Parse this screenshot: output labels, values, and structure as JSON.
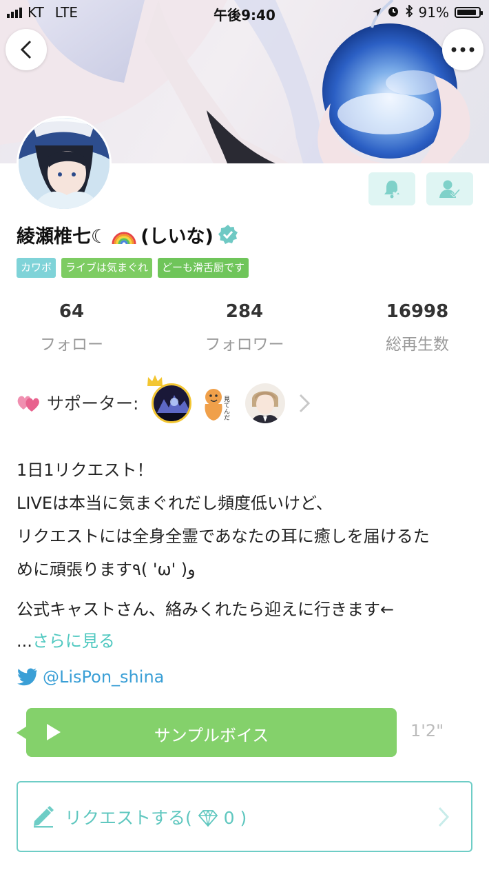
{
  "status_bar": {
    "carrier": "KT",
    "network": "LTE",
    "time": "午後9:40",
    "battery": "91%",
    "battery_level": 0.91
  },
  "header": {
    "back_icon": "chevron-left-icon",
    "more_icon": "more-horizontal-icon"
  },
  "actions": {
    "notify_icon": "bell-check-icon",
    "follow_icon": "user-check-icon",
    "accent": "#dff5f3",
    "icon_color": "#7fd1c9"
  },
  "profile": {
    "name": "綾瀬椎七☾",
    "name_suffix": "(しいな)",
    "rainbow_icon": "rainbow-icon",
    "verified_icon": "verified-badge-icon",
    "tags": [
      {
        "label": "カワボ",
        "color": "#7fd3d8"
      },
      {
        "label": "ライブは気まぐれ",
        "color": "#7dcc62"
      },
      {
        "label": "どーも滑舌厨です",
        "color": "#6fc55a"
      }
    ]
  },
  "stats": [
    {
      "value": "64",
      "label": "フォロー"
    },
    {
      "value": "284",
      "label": "フォロワー"
    },
    {
      "value": "16998",
      "label": "総再生数"
    }
  ],
  "supporters": {
    "label": "サポーター:",
    "heart_icon": "hearts-icon",
    "crown_icon": "crown-icon",
    "chevron_icon": "chevron-right-icon",
    "sticker_text": "見てんだ"
  },
  "bio": {
    "lines": [
      "1日1リクエスト！",
      "LIVEは本当に気まぐれだし頻度低いけど、",
      "リクエストには全身全霊であなたの耳に癒しを届けるた",
      "めに頑張ります٩( 'ω' )و",
      "公式キャストさん、絡みくれたら迎えに行きます←"
    ],
    "ellipsis": "...",
    "more_link": "さらに見る"
  },
  "twitter": {
    "icon": "twitter-bird-icon",
    "handle": "@LisPon_shina",
    "color": "#3a9fd6"
  },
  "sample_voice": {
    "label": "サンプルボイス",
    "duration": "1'2\"",
    "color": "#84d16b",
    "play_icon": "play-icon"
  },
  "request": {
    "label": "リクエストする(",
    "count": "0",
    "close": ")",
    "pencil_icon": "pencil-icon",
    "gem_icon": "diamond-icon",
    "chevron_icon": "chevron-right-icon",
    "color": "#5fc7bf"
  }
}
